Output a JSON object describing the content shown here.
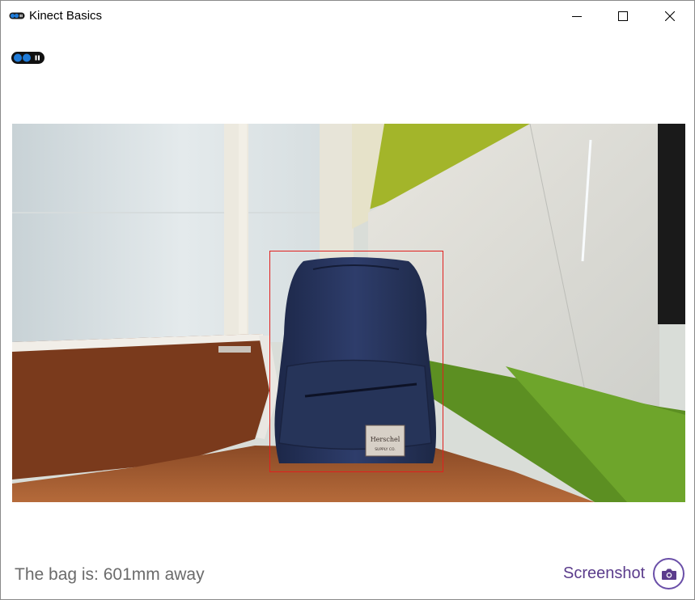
{
  "window": {
    "title": "Kinect Basics",
    "app_icon": "kinect-sensor-icon",
    "controls": {
      "minimize_icon": "minimize-icon",
      "maximize_icon": "maximize-icon",
      "close_icon": "close-icon"
    }
  },
  "sensor": {
    "indicator_icon": "kinect-status-icon"
  },
  "camera": {
    "scene": "color-camera-frame",
    "detection": {
      "box_color": "#e0201e",
      "logo_text": "Herschel",
      "logo_subtext": "SUPPLY CO."
    }
  },
  "footer": {
    "status": "The bag is: 601mm away",
    "screenshot_label": "Screenshot",
    "screenshot_icon": "camera-icon"
  },
  "colors": {
    "accent": "#5b3c8c",
    "status_text": "#6b6b6b"
  }
}
